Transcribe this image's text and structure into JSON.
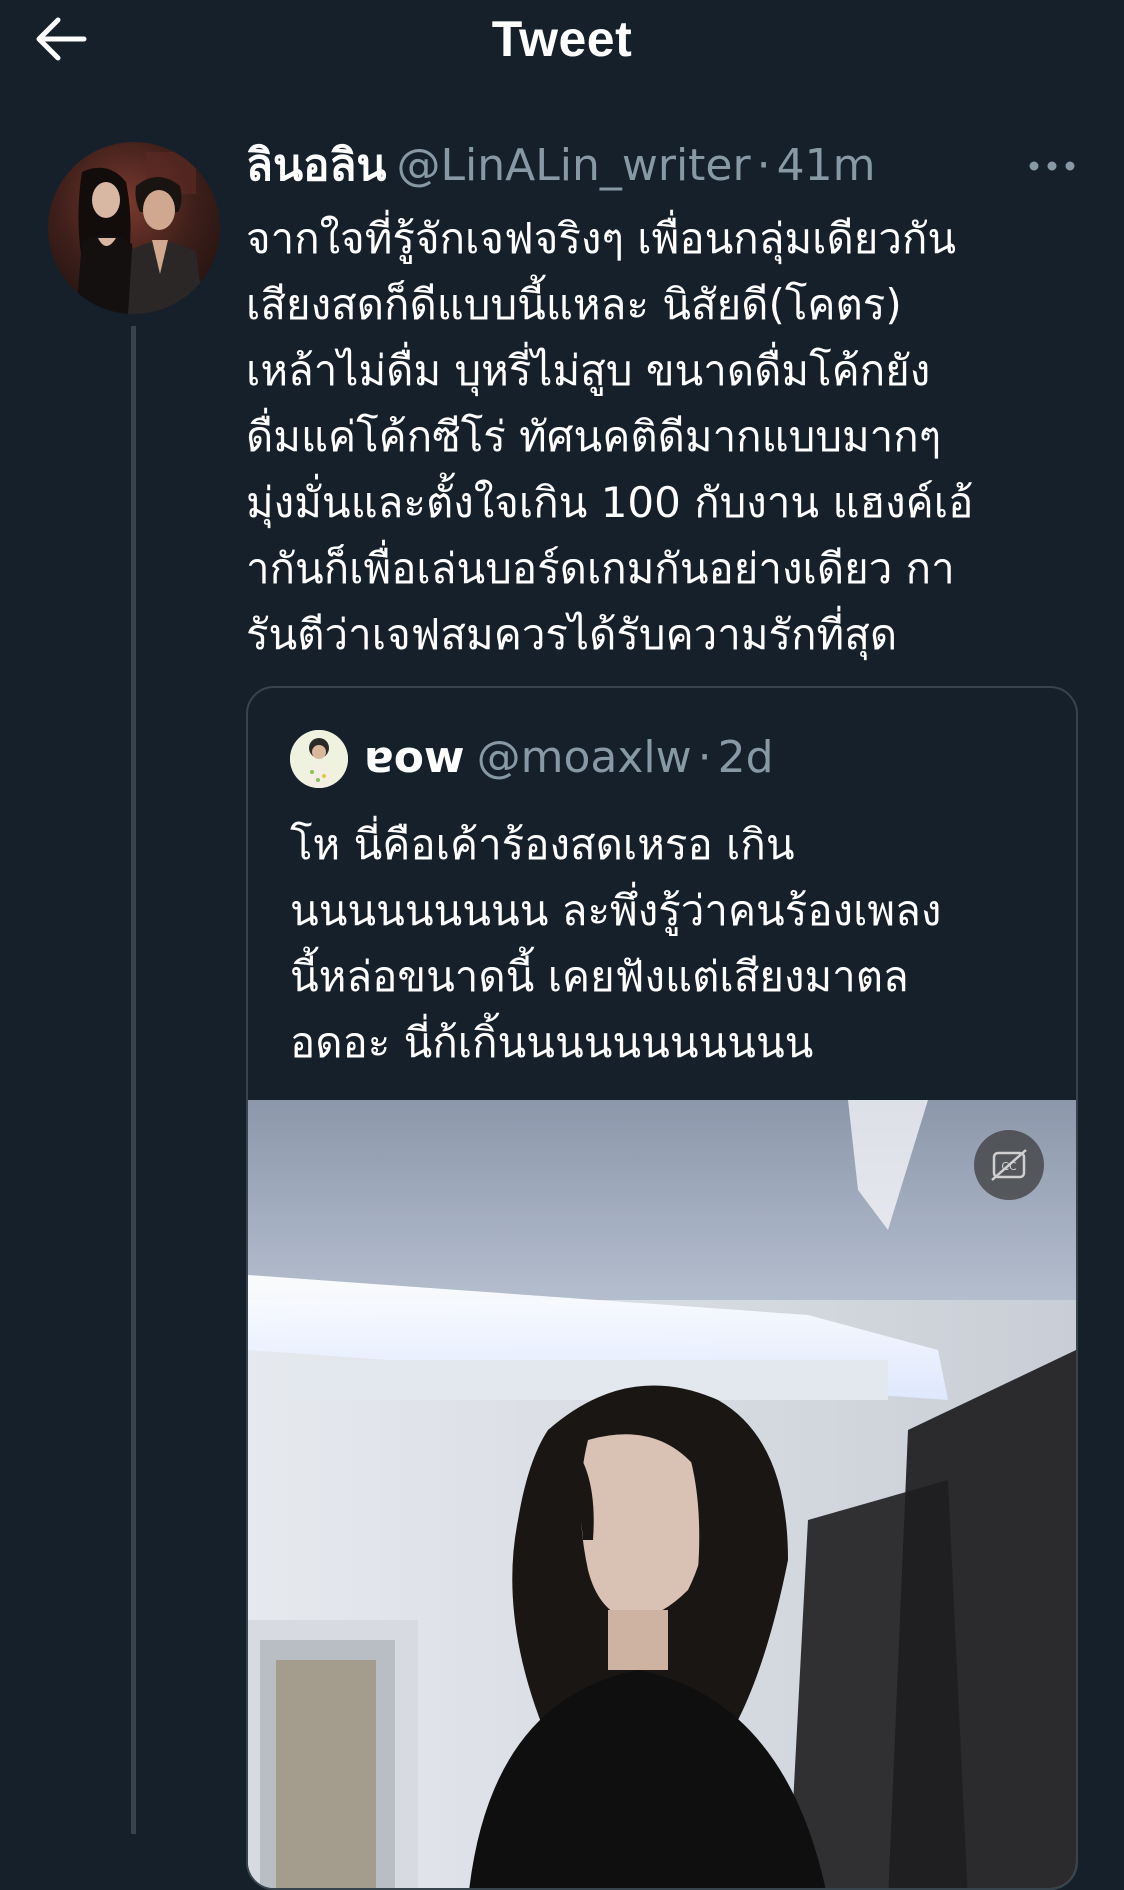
{
  "header": {
    "title": "Tweet",
    "back_icon": "arrow-left-icon"
  },
  "tweet": {
    "display_name": "ลินอลิน",
    "handle": "@LinALin_writer",
    "separator": "·",
    "time": "41m",
    "more_icon": "more-horizontal-icon",
    "text_lines": [
      "จากใจที่รู้จักเจฟจริงๆ เพื่อนกลุ่มเดียวกัน",
      "เสียงสดก็ดีแบบนี้แหละ นิสัยดี(โคตร)",
      "เหล้าไม่ดื่ม บุหรี่ไม่สูบ ขนาดดื่มโค้กยัง",
      "ดื่มแค่โค้กซีโร่ ทัศนคติดีมากแบบมากๆ",
      "มุ่งมั่นและตั้งใจเกิน 100 กับงาน แฮงค์เอ้",
      "ากันก็เพื่อเล่นบอร์ดเกมกันอย่างเดียว กา",
      "รันตีว่าเจฟสมควรได้รับความรักที่สุด"
    ]
  },
  "quote": {
    "display_name": "ɐow",
    "handle": "@moaxlw",
    "separator": "·",
    "time": "2d",
    "text_lines": [
      "โห นี่คือเค้าร้องสดเหรอ เกิน",
      "นนนนนนนนน ละพึ่งรู้ว่าคนร้องเพลง",
      "นี้หล่อขนาดนี้ เคยฟังแต่เสียงมาตล",
      "อดอะ นี่ก้เกิ้นนนนนนนนนนน"
    ],
    "media_control_icon": "captions-off-icon"
  },
  "colors": {
    "background": "#15202b",
    "secondary_text": "#8899a6",
    "border": "#38444d"
  }
}
